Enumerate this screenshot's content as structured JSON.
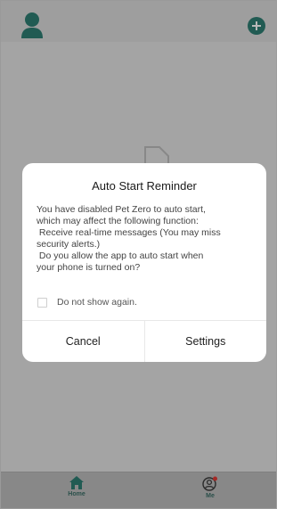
{
  "header": {
    "avatar_icon": "user-icon",
    "add_icon": "plus-circle-icon",
    "accent_color": "#2f7f74"
  },
  "dialog": {
    "title": "Auto Start Reminder",
    "message_lines": [
      "You have disabled Pet Zero to auto start,",
      "which may affect the following function:",
      " Receive real-time messages (You may miss",
      "security alerts.)",
      " Do you allow the app to auto start when",
      "your phone is turned on?"
    ],
    "checkbox_label": "Do not show again.",
    "checkbox_checked": false,
    "cancel_label": "Cancel",
    "confirm_label": "Settings"
  },
  "bottom_nav": {
    "items": [
      {
        "label": "Home",
        "icon": "home-icon",
        "active": true
      },
      {
        "label": "Me",
        "icon": "user-circle-icon",
        "badge": true
      }
    ],
    "badge_color": "#e53935"
  }
}
